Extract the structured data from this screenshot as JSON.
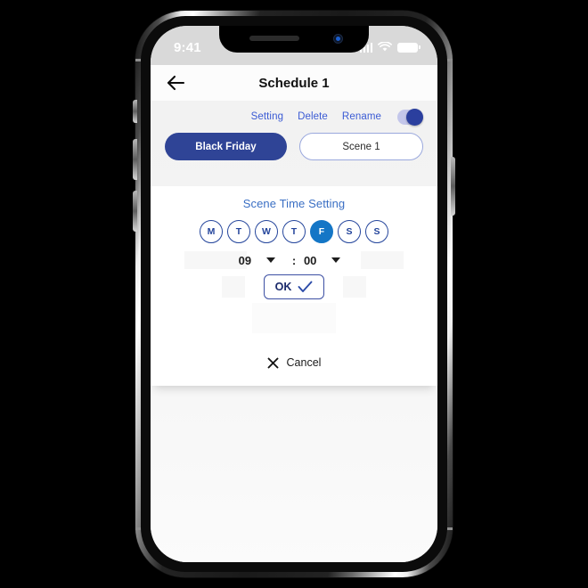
{
  "status_bar": {
    "time": "9:41",
    "icons": [
      "signal-bars-icon",
      "wifi-icon",
      "battery-icon"
    ]
  },
  "nav": {
    "back_icon": "back-arrow-icon",
    "title": "Schedule 1"
  },
  "actions": {
    "setting": "Setting",
    "delete": "Delete",
    "rename": "Rename",
    "toggle_state": "on"
  },
  "scenes": [
    {
      "label": "Black Friday",
      "selected": true
    },
    {
      "label": "Scene 1",
      "selected": false
    }
  ],
  "modal": {
    "title": "Scene Time Setting",
    "days": [
      {
        "label": "M",
        "selected": false
      },
      {
        "label": "T",
        "selected": false
      },
      {
        "label": "W",
        "selected": false
      },
      {
        "label": "T",
        "selected": false
      },
      {
        "label": "F",
        "selected": true
      },
      {
        "label": "S",
        "selected": false
      },
      {
        "label": "S",
        "selected": false
      }
    ],
    "time": {
      "hour": "09",
      "separator": ":",
      "minute": "00",
      "hour_caret_icon": "chevron-down-icon",
      "minute_caret_icon": "chevron-down-icon"
    },
    "ok_label": "OK",
    "ok_check_icon": "check-icon",
    "cancel_label": "Cancel",
    "cancel_icon": "close-x-icon"
  },
  "colors": {
    "brand_navy": "#2f4496",
    "link_blue": "#3b5bd4",
    "title_blue": "#3a6fc4",
    "day_selected": "#1476c6",
    "day_outline": "#23449b",
    "toggle_track": "#c3c6ea",
    "toggle_knob": "#2b3f9e"
  }
}
